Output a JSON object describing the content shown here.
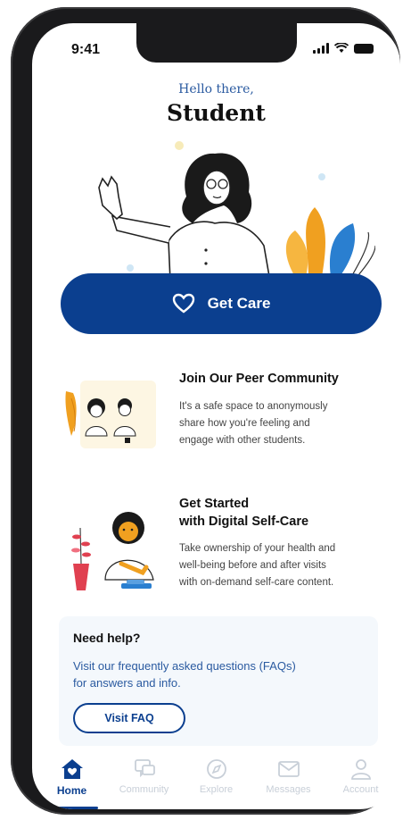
{
  "status_bar": {
    "time": "9:41"
  },
  "header": {
    "greeting": "Hello there,",
    "name": "Student"
  },
  "primary_action": {
    "label": "Get Care",
    "icon": "heart-icon"
  },
  "cards": [
    {
      "title": "Join Our Peer Community",
      "text_lines": [
        "It's a safe space to anonymously",
        "share how you're feeling and",
        "engage with other students."
      ]
    },
    {
      "title_lines": [
        "Get Started",
        "with Digital Self-Care"
      ],
      "text_lines": [
        "Take ownership of your health and",
        "well-being before and after visits",
        "with on-demand self-care content."
      ]
    }
  ],
  "help": {
    "title": "Need help?",
    "text_lines": [
      "Visit our frequently asked questions (FAQs)",
      "for answers and info."
    ],
    "button_label": "Visit FAQ"
  },
  "tabs": [
    {
      "label": "Home",
      "icon": "home-heart-icon",
      "active": true
    },
    {
      "label": "Community",
      "icon": "chat-bubbles-icon",
      "active": false
    },
    {
      "label": "Explore",
      "icon": "compass-icon",
      "active": false
    },
    {
      "label": "Messages",
      "icon": "mail-icon",
      "active": false
    },
    {
      "label": "Account",
      "icon": "person-icon",
      "active": false
    }
  ],
  "colors": {
    "primary": "#0b3f8f",
    "accent_orange": "#f0a020",
    "accent_blue": "#2a7fd0",
    "inactive": "#c8cfd8"
  }
}
